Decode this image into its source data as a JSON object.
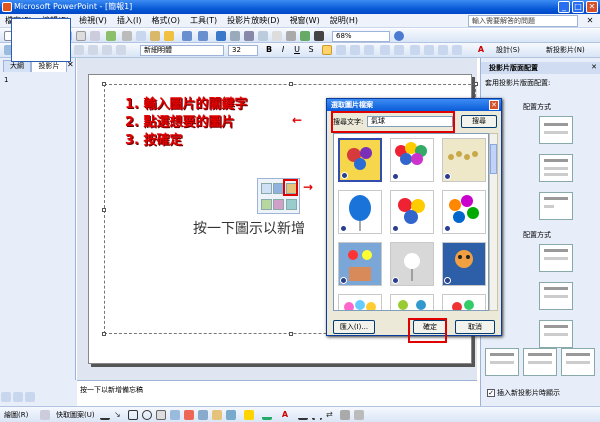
{
  "window": {
    "title": "Microsoft PowerPoint - [簡報1]"
  },
  "menu": {
    "items": [
      "檔案(F)",
      "編輯(E)",
      "檢視(V)",
      "插入(I)",
      "格式(O)",
      "工具(T)",
      "投影片放映(D)",
      "視窗(W)",
      "說明(H)"
    ],
    "help_placeholder": "輸入需要解答的問題"
  },
  "toolbar": {
    "zoom": "68%",
    "font_name": "新細明體",
    "font_size": "32",
    "design_label": "設計(S)",
    "new_slide_label": "新投影片(N)"
  },
  "left_pane": {
    "tabs": [
      "大綱",
      "投影片"
    ],
    "slide_number": "1"
  },
  "slide": {
    "instructions": [
      "1. 輸入圖片的關鍵字",
      "2. 點選想要的圖片",
      "3. 按確定"
    ],
    "placeholder_text": "按一下圖示以新增"
  },
  "notes": {
    "text": "按一下以新增備忘稿"
  },
  "right_pane": {
    "title": "投影片版面配置",
    "apply_label": "套用投影片版面配置:",
    "section1": "配置方式",
    "section2": "配置方式",
    "checkbox_label": "插入新投影片時顯示",
    "checkbox_checked": true
  },
  "dialog": {
    "title": "選取圖片檔案",
    "search_label": "搜尋文字:",
    "search_value": "氣球",
    "search_button": "搜尋",
    "import_button": "匯入(I)...",
    "ok_button": "確定",
    "cancel_button": "取消",
    "images": [
      "balloons-clip-1",
      "balloons-clip-2",
      "balloons-clip-3",
      "balloons-clip-4",
      "balloons-clip-5",
      "balloons-clip-6",
      "balloons-clip-7",
      "balloons-clip-8",
      "balloons-clip-9",
      "balloons-clip-10",
      "balloons-clip-11",
      "balloons-clip-12"
    ]
  },
  "drawbar": {
    "draw_label": "繪圖(R)",
    "autoshape_label": "快取圖案(U)"
  },
  "colors": {
    "accent": "#0a5bd8",
    "annotation": "#e00000"
  }
}
